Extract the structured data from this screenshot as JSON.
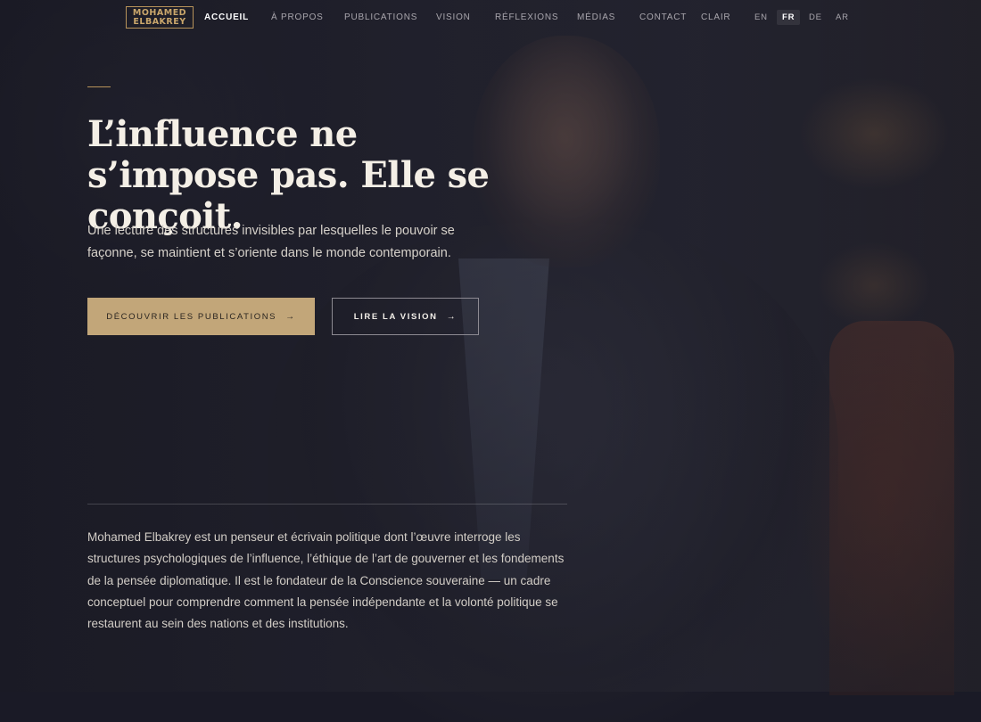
{
  "brand": {
    "logo_line1": "MOHAMED",
    "logo_line2": "ELBAKREY",
    "accent_color": "#c2a679"
  },
  "nav": {
    "items": [
      {
        "label": "ACCUEIL",
        "active": true
      },
      {
        "label": "À PROPOS"
      },
      {
        "label": "PUBLICATIONS"
      },
      {
        "label": "VISION"
      },
      {
        "label": "RÉFLEXIONS"
      },
      {
        "label": "MÉDIAS"
      },
      {
        "label": "CONTACT"
      }
    ],
    "theme_toggle": "CLAIR",
    "languages": [
      {
        "code": "EN"
      },
      {
        "code": "FR",
        "active": true
      },
      {
        "code": "DE"
      },
      {
        "code": "AR"
      }
    ]
  },
  "hero": {
    "headline": "L’influence ne s’impose pas. Elle se conçoit.",
    "lede": "Une lecture des structures invisibles par lesquelles le pouvoir se façonne, se maintient et s’oriente dans le monde contemporain.",
    "primary_cta": "DÉCOUVRIR LES PUBLICATIONS",
    "secondary_cta": "LIRE LA VISION",
    "arrow_icon": "→"
  },
  "bio": {
    "text": "Mohamed Elbakrey est un penseur et écrivain politique dont l’œuvre interroge les structures psychologiques de l’influence, l’éthique de l’art de gouverner et les fondements de la pensée diplomatique. Il est le fondateur de la Conscience souveraine — un cadre conceptuel pour comprendre comment la pensée indépendante et la volonté politique se restaurent au sein des nations et des institutions."
  }
}
